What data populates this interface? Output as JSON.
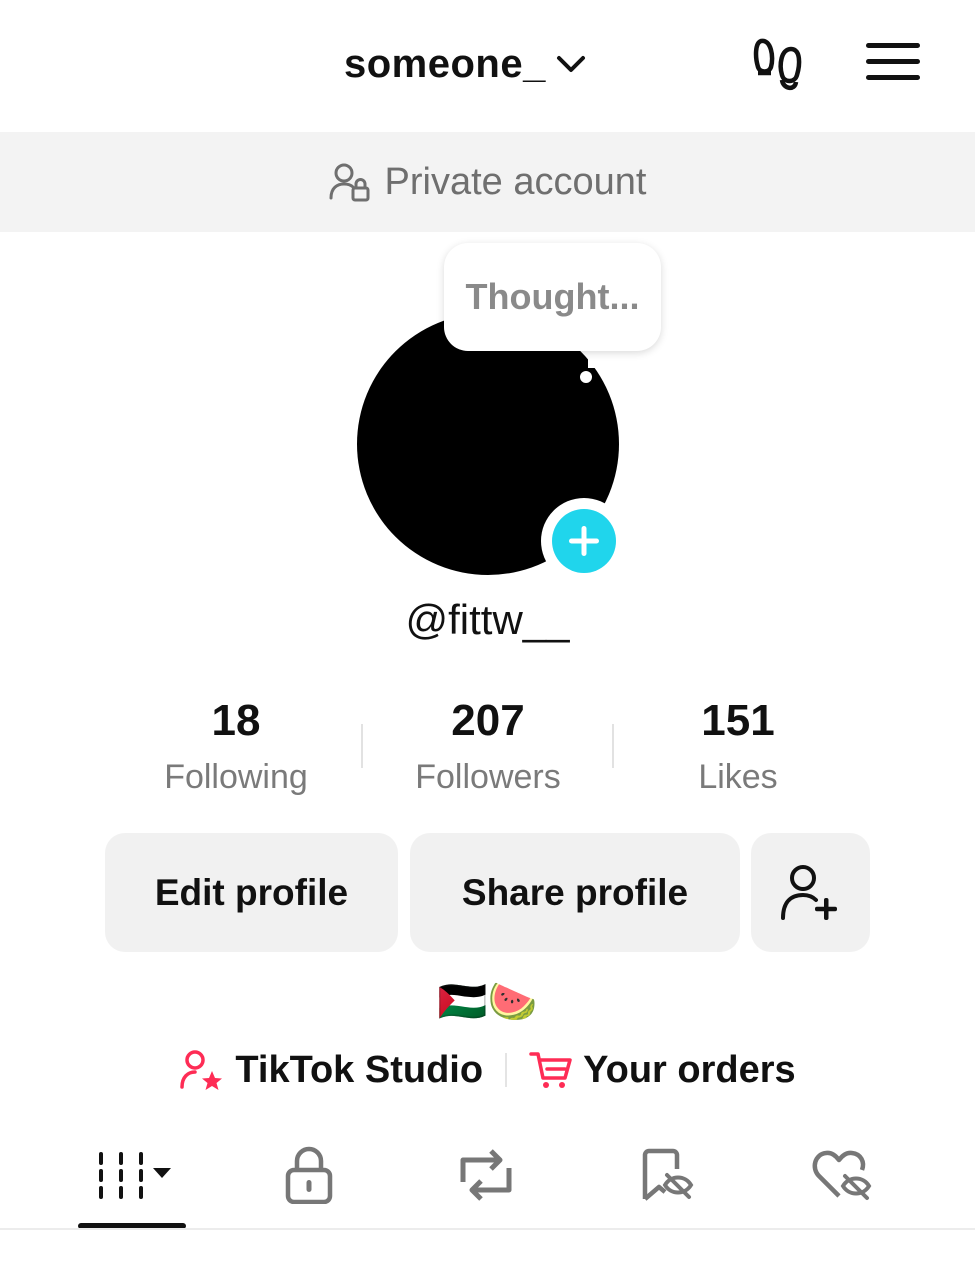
{
  "header": {
    "username": "someone_",
    "icons": [
      "chevron-down-icon",
      "footprints-icon",
      "menu-icon"
    ]
  },
  "private_banner": {
    "text": "Private account",
    "icon": "person-lock-icon"
  },
  "profile": {
    "thought_bubble": "Thought...",
    "handle": "@fittw__",
    "avatar_color": "#000000",
    "add_story_color": "#20d5ec"
  },
  "stats": [
    {
      "value": "18",
      "label": "Following"
    },
    {
      "value": "207",
      "label": "Followers"
    },
    {
      "value": "151",
      "label": "Likes"
    }
  ],
  "buttons": {
    "edit_profile": "Edit profile",
    "share_profile": "Share profile",
    "add_friend_icon": "add-user-icon"
  },
  "bio": {
    "emoji": "🇵🇸🍉"
  },
  "links": {
    "studio": "TikTok Studio",
    "orders": "Your orders",
    "accent_color": "#fe2c55"
  },
  "tabs": [
    {
      "name": "videos",
      "icon": "grid-icon",
      "active": true
    },
    {
      "name": "private",
      "icon": "lock-icon",
      "active": false
    },
    {
      "name": "reposts",
      "icon": "repost-icon",
      "active": false
    },
    {
      "name": "favorites",
      "icon": "bookmark-hidden-icon",
      "active": false
    },
    {
      "name": "liked",
      "icon": "heart-hidden-icon",
      "active": false
    }
  ]
}
